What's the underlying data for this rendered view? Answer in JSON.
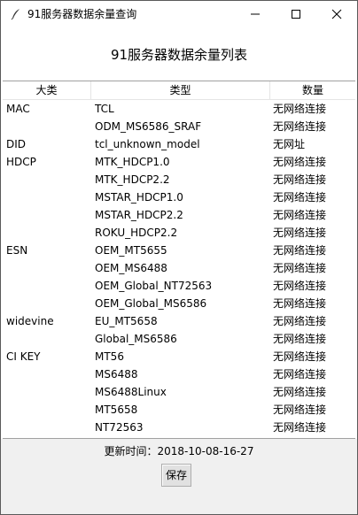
{
  "window": {
    "title": "91服务器数据余量查询"
  },
  "heading": "91服务器数据余量列表",
  "table": {
    "headers": [
      "大类",
      "类型",
      "数量"
    ],
    "rows": [
      {
        "category": "MAC",
        "type": "TCL",
        "count": "无网络连接"
      },
      {
        "category": "",
        "type": "ODM_MS6586_SRAF",
        "count": "无网络连接"
      },
      {
        "category": "DID",
        "type": "tcl_unknown_model",
        "count": "无网址"
      },
      {
        "category": "HDCP",
        "type": "MTK_HDCP1.0",
        "count": "无网络连接"
      },
      {
        "category": "",
        "type": "MTK_HDCP2.2",
        "count": "无网络连接"
      },
      {
        "category": "",
        "type": "MSTAR_HDCP1.0",
        "count": "无网络连接"
      },
      {
        "category": "",
        "type": "MSTAR_HDCP2.2",
        "count": "无网络连接"
      },
      {
        "category": "",
        "type": "ROKU_HDCP2.2",
        "count": "无网络连接"
      },
      {
        "category": "ESN",
        "type": "OEM_MT5655",
        "count": "无网络连接"
      },
      {
        "category": "",
        "type": "OEM_MS6488",
        "count": "无网络连接"
      },
      {
        "category": "",
        "type": "OEM_Global_NT72563",
        "count": "无网络连接"
      },
      {
        "category": "",
        "type": "OEM_Global_MS6586",
        "count": "无网络连接"
      },
      {
        "category": "widevine",
        "type": "EU_MT5658",
        "count": "无网络连接"
      },
      {
        "category": "",
        "type": "Global_MS6586",
        "count": "无网络连接"
      },
      {
        "category": "CI KEY",
        "type": "MT56",
        "count": "无网络连接"
      },
      {
        "category": "",
        "type": "MS6488",
        "count": "无网络连接"
      },
      {
        "category": "",
        "type": "MS6488Linux",
        "count": "无网络连接"
      },
      {
        "category": "",
        "type": "MT5658",
        "count": "无网络连接"
      },
      {
        "category": "",
        "type": "NT72563",
        "count": "无网络连接"
      }
    ]
  },
  "footer": {
    "update_time": "更新时间：2018-10-08-16-27",
    "save_label": "保存"
  },
  "icons": {
    "app": "feather-icon",
    "minimize": "minimize-icon",
    "maximize": "maximize-icon",
    "close": "close-icon"
  }
}
